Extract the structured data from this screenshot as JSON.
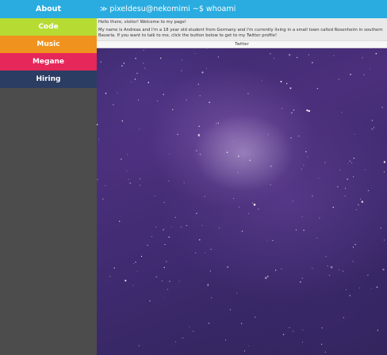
{
  "sidebar": {
    "items": [
      {
        "label": "About",
        "color": "#2aace0"
      },
      {
        "label": "Code",
        "color": "#b6dc34"
      },
      {
        "label": "Music",
        "color": "#f0921e"
      },
      {
        "label": "Megane",
        "color": "#e6275a"
      },
      {
        "label": "Hiring",
        "color": "#2c3d63"
      }
    ],
    "background": "#4c4c4c"
  },
  "header": {
    "prompt_icon": "≫",
    "command": "pixeldesu@nekomimi ~$ whoami",
    "color": "#2aace0"
  },
  "content": {
    "greeting": "Hello there, visitor! Welcome to my page!",
    "bio": "My name is Andreas and I'm a 18 year old student from Germany and I'm currently living in a small town called Rosenheim in southern Bavaria. If you want to talk to me, click the button below to get to my Twitter profile!",
    "twitter_button": "Twitter"
  },
  "background": {
    "icon": "galaxy-background-image"
  }
}
